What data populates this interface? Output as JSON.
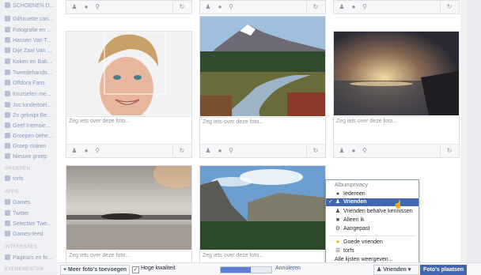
{
  "sidebar": {
    "items": [
      "SCHOENEN D...",
      "Gilhouette can...",
      "Fotografie en ...",
      "Hassen Van T...",
      "Dije Zaal Van ...",
      "Koken en Bak...",
      "Tweedehands...",
      "Offdora Fans",
      "Knutselen me...",
      "Joc kindertoel...",
      "Zo geknipt Be...",
      "Geef Intensie...",
      "Groepen behe...",
      "Groep maken",
      "Nieuwe groep"
    ],
    "section_groepen": "GROEPEN",
    "groepen_items": [
      "torfs"
    ],
    "section_apps": "APPS",
    "apps_items": [
      "Games",
      "Twitter",
      "Selective Twe...",
      "Games-feed"
    ],
    "section_interesses": "INTERESSES",
    "interesses_items": [
      "Pagina's en fe..."
    ],
    "section_evenementen": "EVENEMENTEN"
  },
  "photos": [
    {
      "caption": "Zeg iets over deze foto..."
    },
    {
      "caption": "Zeg iets over deze foto..."
    },
    {
      "caption": "Zeg iets over deze foto..."
    },
    {
      "caption": "Zeg iets over deze foto..."
    },
    {
      "caption": "Zeg iets over deze foto..."
    }
  ],
  "bottom_bar": {
    "more_photos": "Meer foto's toevoegen",
    "high_quality": "Hoge kwaliteit",
    "high_quality_checked": true,
    "upload_progress": 0.6,
    "cancel": "Annuleren",
    "privacy_button": "Vrienden",
    "post_photos": "Foto's plaatsen"
  },
  "privacy_menu": {
    "title": "Albumprivacy",
    "options": [
      {
        "label": "Iedereen",
        "icon": "globe-icon",
        "selected": false
      },
      {
        "label": "Vrienden",
        "icon": "friends-icon",
        "selected": true
      },
      {
        "label": "Vrienden behalve kennissen",
        "icon": "friends-icon",
        "selected": false
      },
      {
        "label": "Alleen ik",
        "icon": "lock-icon",
        "selected": false
      },
      {
        "label": "Aangepast",
        "icon": "gear-icon",
        "selected": false
      }
    ],
    "lists": [
      {
        "label": "Goede vrienden",
        "icon": "star-icon"
      },
      {
        "label": "torfs",
        "icon": "list-icon"
      }
    ],
    "show_all": "Alle lijsten weergeven..."
  },
  "colors": {
    "accent": "#4267b2",
    "link": "#3b5998"
  }
}
